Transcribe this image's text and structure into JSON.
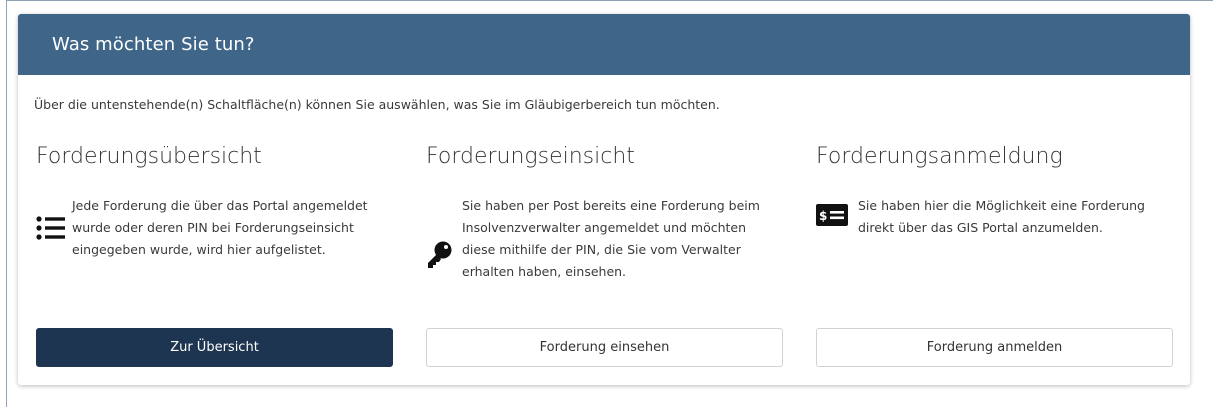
{
  "panel": {
    "title": "Was möchten Sie tun?",
    "intro": "Über die untenstehende(n) Schaltfläche(n) können Sie auswählen, was Sie im Gläubigerbereich tun möchten."
  },
  "options": [
    {
      "title": "Forderungsübersicht",
      "icon": "list-icon",
      "description": "Jede Forderung die über das Portal angemeldet wurde oder deren PIN bei Forderungseinsicht eingegeben wurde, wird hier aufgelistet.",
      "button": "Zur Übersicht"
    },
    {
      "title": "Forderungseinsicht",
      "icon": "key-icon",
      "description": "Sie haben per Post bereits eine Forderung beim Insolvenzverwalter angemeldet und möchten diese mithilfe der PIN, die Sie vom Verwalter erhalten haben, einsehen.",
      "button": "Forderung einsehen"
    },
    {
      "title": "Forderungsanmeldung",
      "icon": "money-bill-icon",
      "description": "Sie haben hier die Möglichkeit eine Forderung direkt über das GIS Portal anzumelden.",
      "button": "Forderung anmelden"
    }
  ],
  "colors": {
    "header": "#3f6689",
    "primary_button": "#1d3550"
  }
}
